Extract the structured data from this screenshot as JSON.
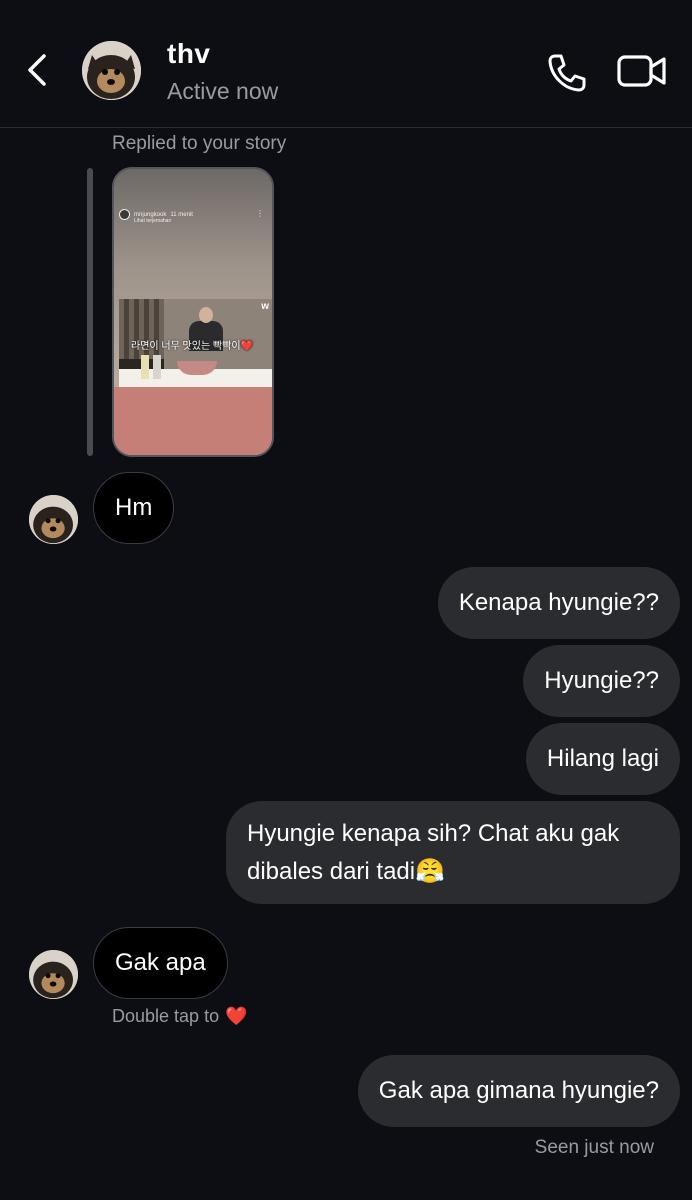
{
  "header": {
    "name": "thv",
    "status": "Active now"
  },
  "story": {
    "caption": "Replied to your story",
    "username": "mnjungkook",
    "time": "11 menit",
    "translate": "Lihat terjemahan",
    "overlay_text": "라면이 너무 맛있는 빡빡이",
    "heart": "❤️",
    "watermark": "w"
  },
  "messages": {
    "m1": "Hm",
    "m2": "Kenapa hyungie??",
    "m3": "Hyungie??",
    "m4": "Hilang lagi",
    "m5": "Hyungie kenapa sih? Chat aku gak dibales dari tadi😤",
    "m6": "Gak apa",
    "m7": "Gak apa gimana hyungie?"
  },
  "tap_hint": "Double tap to",
  "tap_heart": "❤️",
  "seen": "Seen just now",
  "colors": {
    "background": "#0d0e14",
    "outgoing_bubble": "#2b2c30",
    "incoming_bubble": "#000000",
    "muted_text": "#9a9ba2",
    "heart": "#e01e2b"
  },
  "icons": [
    "chevron-left-icon",
    "phone-icon",
    "video-camera-icon"
  ]
}
